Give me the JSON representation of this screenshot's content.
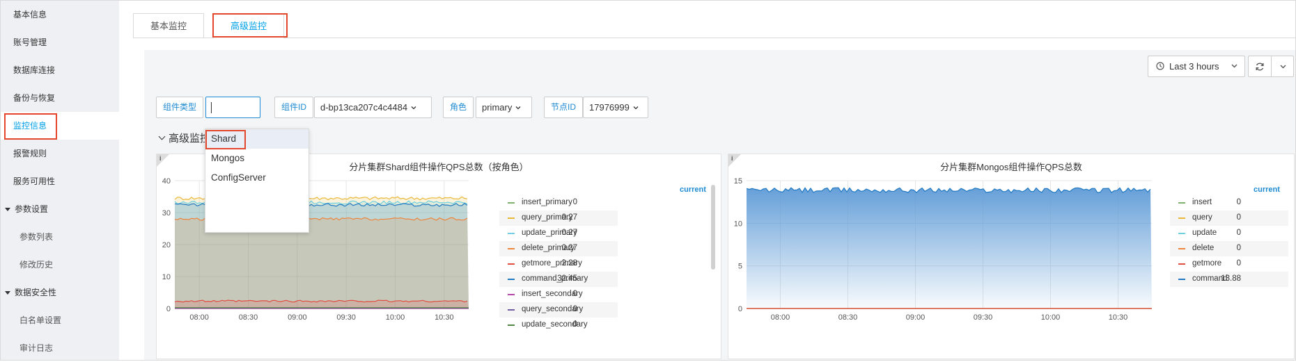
{
  "sidebar": {
    "items": [
      {
        "label": "基本信息"
      },
      {
        "label": "账号管理"
      },
      {
        "label": "数据库连接"
      },
      {
        "label": "备份与恢复"
      },
      {
        "label": "监控信息"
      },
      {
        "label": "报警规则"
      },
      {
        "label": "服务可用性"
      },
      {
        "label": "参数设置"
      },
      {
        "label": "参数列表"
      },
      {
        "label": "修改历史"
      },
      {
        "label": "数据安全性"
      },
      {
        "label": "白名单设置"
      },
      {
        "label": "审计日志"
      }
    ]
  },
  "tabs": [
    {
      "label": "基本监控"
    },
    {
      "label": "高级监控"
    }
  ],
  "toolbar": {
    "time_range": "Last 3 hours"
  },
  "variables": {
    "component_type_label": "组件类型",
    "component_type_value": "",
    "component_id_label": "组件ID",
    "component_id_value": "d-bp13ca207c4c4484",
    "role_label": "角色",
    "role_value": "primary",
    "node_id_label": "节点ID",
    "node_id_value": "17976999"
  },
  "dropdown": {
    "options": [
      "Shard",
      "Mongos",
      "ConfigServer"
    ]
  },
  "row": {
    "title": "高级监控"
  },
  "legend_header": "current",
  "colors": {
    "accent": "#00a0e9",
    "highlight": "#e4462c"
  },
  "chart_data": [
    {
      "type": "area",
      "title": "分片集群Shard组件操作QPS总数（按角色）",
      "x": [
        "08:00",
        "08:30",
        "09:00",
        "09:30",
        "10:00",
        "10:30"
      ],
      "ylim": [
        0,
        40
      ],
      "yticks": [
        0,
        10,
        20,
        30,
        40
      ],
      "series": [
        {
          "name": "insert_primary",
          "color": "#7eb26d",
          "current": "0",
          "level": 0
        },
        {
          "name": "query_primary",
          "color": "#eab839",
          "current": "0.27",
          "level": 34.5
        },
        {
          "name": "update_primary",
          "color": "#6ed0e0",
          "current": "0.27",
          "level": 33.2
        },
        {
          "name": "delete_primary",
          "color": "#ef843c",
          "current": "0.27",
          "level": 28
        },
        {
          "name": "getmore_primary",
          "color": "#e24d42",
          "current": "2.28",
          "level": 2.3
        },
        {
          "name": "command_primary",
          "color": "#1f78c1",
          "current": "32.45",
          "level": 32.45
        },
        {
          "name": "insert_secondary",
          "color": "#ba43a9",
          "current": "0",
          "level": 0
        },
        {
          "name": "query_secondary",
          "color": "#705da0",
          "current": "0",
          "level": 0
        },
        {
          "name": "update_secondary",
          "color": "#508642",
          "current": "0",
          "level": 0
        }
      ]
    },
    {
      "type": "area",
      "title": "分片集群Mongos组件操作QPS总数",
      "x": [
        "08:00",
        "08:30",
        "09:00",
        "09:30",
        "10:00",
        "10:30"
      ],
      "ylim": [
        0,
        15
      ],
      "yticks": [
        0,
        5,
        10,
        15
      ],
      "series": [
        {
          "name": "insert",
          "color": "#7eb26d",
          "current": "0",
          "level": 0
        },
        {
          "name": "query",
          "color": "#eab839",
          "current": "0",
          "level": 0
        },
        {
          "name": "update",
          "color": "#6ed0e0",
          "current": "0",
          "level": 0
        },
        {
          "name": "delete",
          "color": "#ef843c",
          "current": "0",
          "level": 0
        },
        {
          "name": "getmore",
          "color": "#e24d42",
          "current": "0",
          "level": 0
        },
        {
          "name": "command",
          "color": "#1f78c1",
          "current": "13.88",
          "level": 13.88
        }
      ]
    }
  ]
}
